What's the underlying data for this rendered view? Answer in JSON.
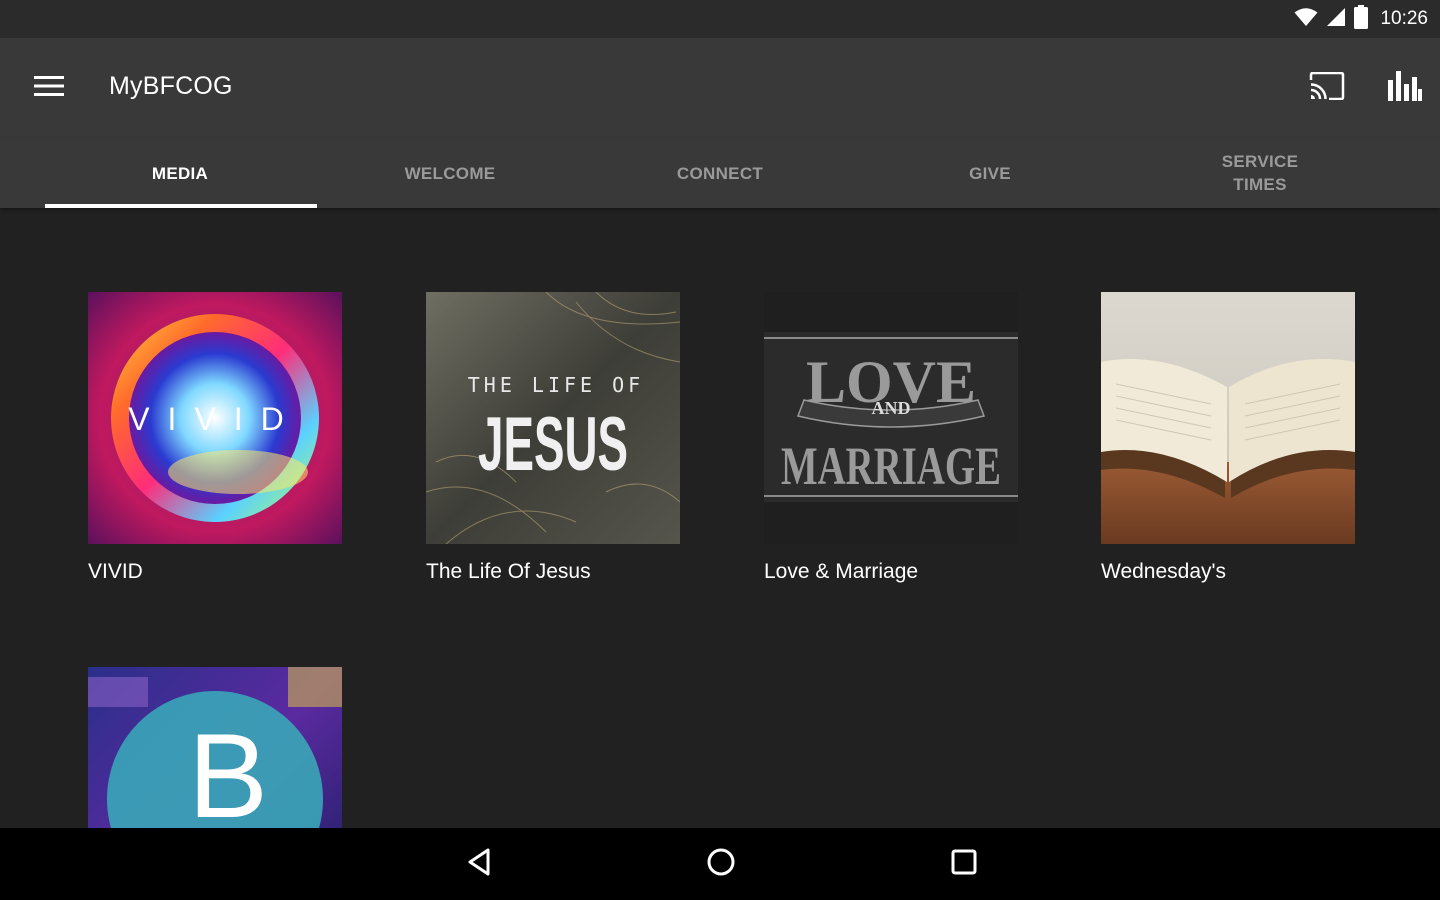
{
  "status_bar": {
    "time": "10:26"
  },
  "app_bar": {
    "title": "MyBFCOG"
  },
  "tabs": [
    {
      "label": "MEDIA",
      "active": true
    },
    {
      "label": "WELCOME",
      "active": false
    },
    {
      "label": "CONNECT",
      "active": false
    },
    {
      "label": "GIVE",
      "active": false
    },
    {
      "label": "SERVICE\nTIMES",
      "active": false
    }
  ],
  "media": {
    "items": [
      {
        "title": "VIVID",
        "art_text": "VIVID"
      },
      {
        "title": "The Life Of Jesus",
        "art_small": "THE LIFE OF",
        "art_big": "JESUS"
      },
      {
        "title": "Love & Marriage",
        "art_top": "LOVE",
        "art_mid": "AND",
        "art_bottom": "MARRIAGE"
      },
      {
        "title": "Wednesday's"
      },
      {
        "title": "",
        "art_letter": "B"
      }
    ]
  },
  "icons": {
    "menu": "hamburger-menu-icon",
    "cast": "cast-icon",
    "stats": "bar-chart-icon",
    "wifi": "wifi-icon",
    "signal": "cell-signal-icon",
    "battery": "battery-icon",
    "back": "back-triangle-icon",
    "home": "home-circle-icon",
    "recents": "recents-square-icon"
  },
  "colors": {
    "background": "#212121",
    "app_bar": "#393939",
    "status_bar": "#2b2b2b",
    "tab_inactive": "#9a9a9a",
    "indicator": "#ffffff"
  }
}
